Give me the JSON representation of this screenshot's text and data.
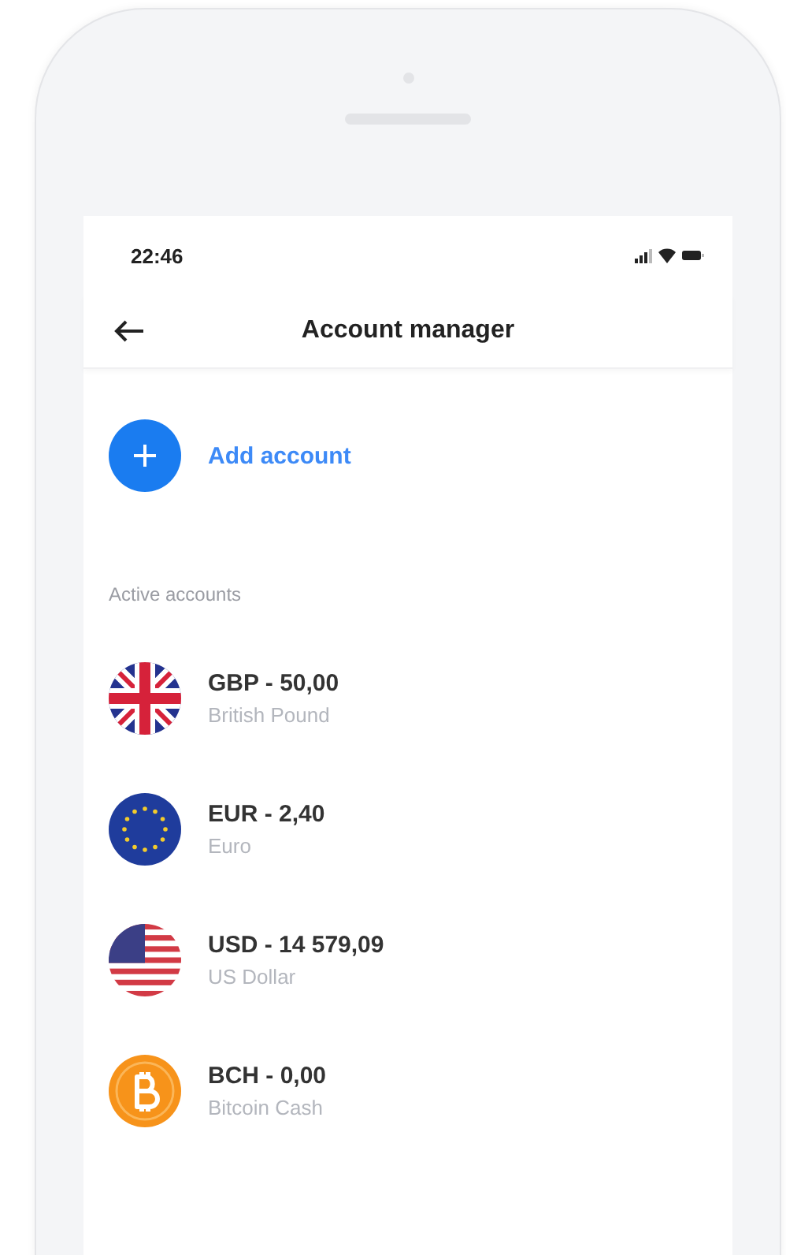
{
  "status_bar": {
    "time": "22:46"
  },
  "header": {
    "title": "Account manager"
  },
  "add_account": {
    "label": "Add account"
  },
  "section_label": "Active accounts",
  "accounts": [
    {
      "kind": "gbp",
      "title": "GBP - 50,00",
      "subtitle": "British Pound"
    },
    {
      "kind": "eur",
      "title": "EUR - 2,40",
      "subtitle": "Euro"
    },
    {
      "kind": "usd",
      "title": "USD - 14 579,09",
      "subtitle": "US Dollar"
    },
    {
      "kind": "bch",
      "title": "BCH - 0,00",
      "subtitle": "Bitcoin Cash"
    }
  ]
}
